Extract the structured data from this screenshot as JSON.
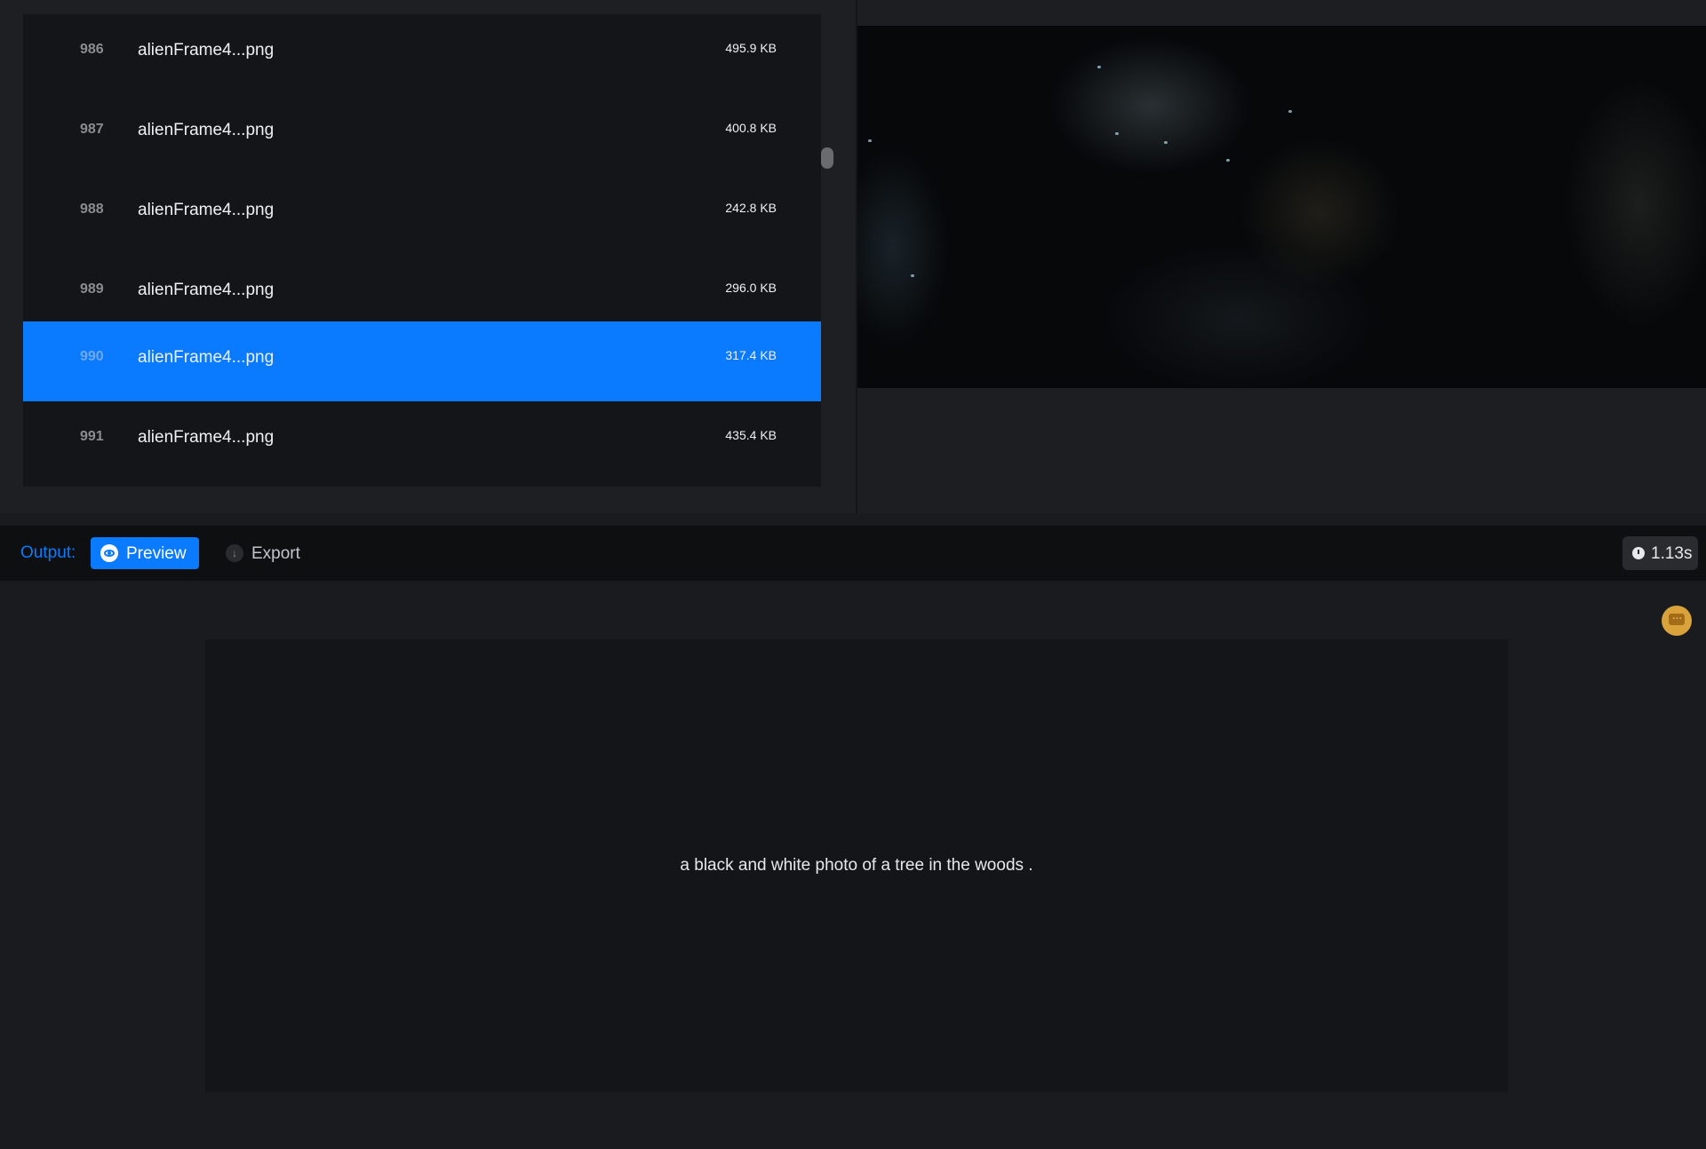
{
  "file_list": {
    "rows": [
      {
        "index": "986",
        "name": "alienFrame4...png",
        "size": "495.9 KB",
        "selected": false
      },
      {
        "index": "987",
        "name": "alienFrame4...png",
        "size": "400.8 KB",
        "selected": false
      },
      {
        "index": "988",
        "name": "alienFrame4...png",
        "size": "242.8 KB",
        "selected": false
      },
      {
        "index": "989",
        "name": "alienFrame4...png",
        "size": "296.0 KB",
        "selected": false
      },
      {
        "index": "990",
        "name": "alienFrame4...png",
        "size": "317.4 KB",
        "selected": true
      },
      {
        "index": "991",
        "name": "alienFrame4...png",
        "size": "435.4 KB",
        "selected": false
      }
    ]
  },
  "toolbar": {
    "output_label": "Output:",
    "preview_label": "Preview",
    "export_label": "Export",
    "elapsed_time": "1.13s",
    "preview_icon": "eye-icon",
    "export_icon": "download-icon",
    "timer_icon": "clock-icon"
  },
  "output": {
    "caption": "a black and white photo of a tree in the woods .",
    "feedback_icon": "chat-bubble-icon"
  },
  "colors": {
    "accent": "#0a7aff",
    "panel_bg": "#141518",
    "feedback_badge": "#d9a23a"
  }
}
